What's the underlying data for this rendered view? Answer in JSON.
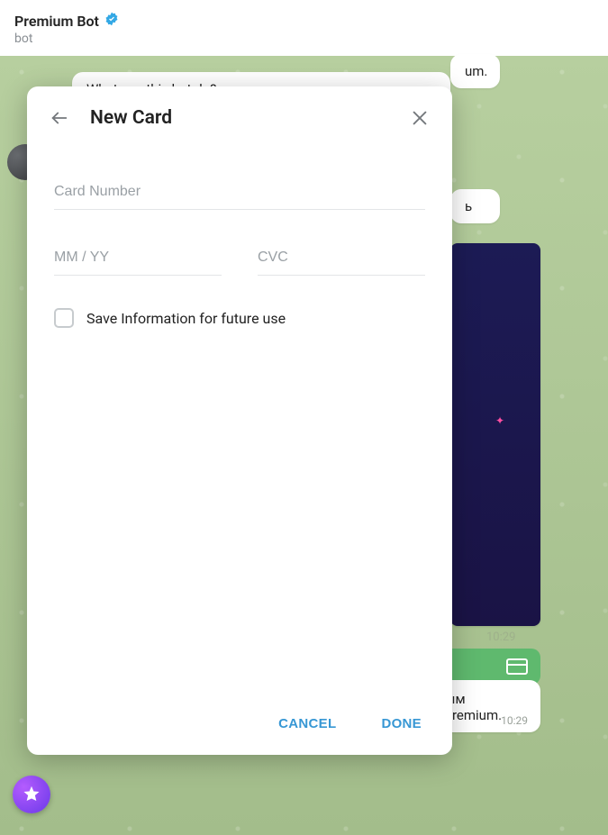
{
  "header": {
    "title": "Premium Bot",
    "subtitle": "bot"
  },
  "chat": {
    "intro_bubble": "What can this bot do?",
    "frag_um": "um.",
    "frag_b": "ь",
    "media_time": "10:29",
    "bottom_text": "Оплатите этот счет, чтобы получить доступ к эксклюзивным функциям, доступным только для подписчиков Telegram Premium.",
    "bottom_time": "10:29"
  },
  "modal": {
    "title": "New Card",
    "card_number_placeholder": "Card Number",
    "expiry_placeholder": "MM / YY",
    "cvc_placeholder": "CVC",
    "save_checkbox_label": "Save Information for future use",
    "cancel_label": "CANCEL",
    "done_label": "DONE"
  }
}
